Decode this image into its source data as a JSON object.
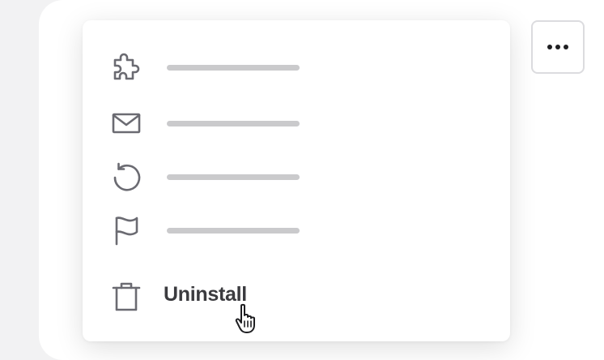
{
  "more_button": {
    "icon": "more-horizontal-icon"
  },
  "menu": {
    "items": [
      {
        "icon": "puzzle-icon",
        "label": ""
      },
      {
        "icon": "mail-icon",
        "label": ""
      },
      {
        "icon": "refresh-icon",
        "label": ""
      },
      {
        "icon": "flag-icon",
        "label": ""
      },
      {
        "icon": "trash-icon",
        "label": "Uninstall"
      }
    ]
  },
  "cursor": {
    "icon": "pointer-hand-icon"
  },
  "colors": {
    "icon": "#6b6b72",
    "text": "#3b3b3f",
    "placeholder_line": "#cacacc"
  }
}
